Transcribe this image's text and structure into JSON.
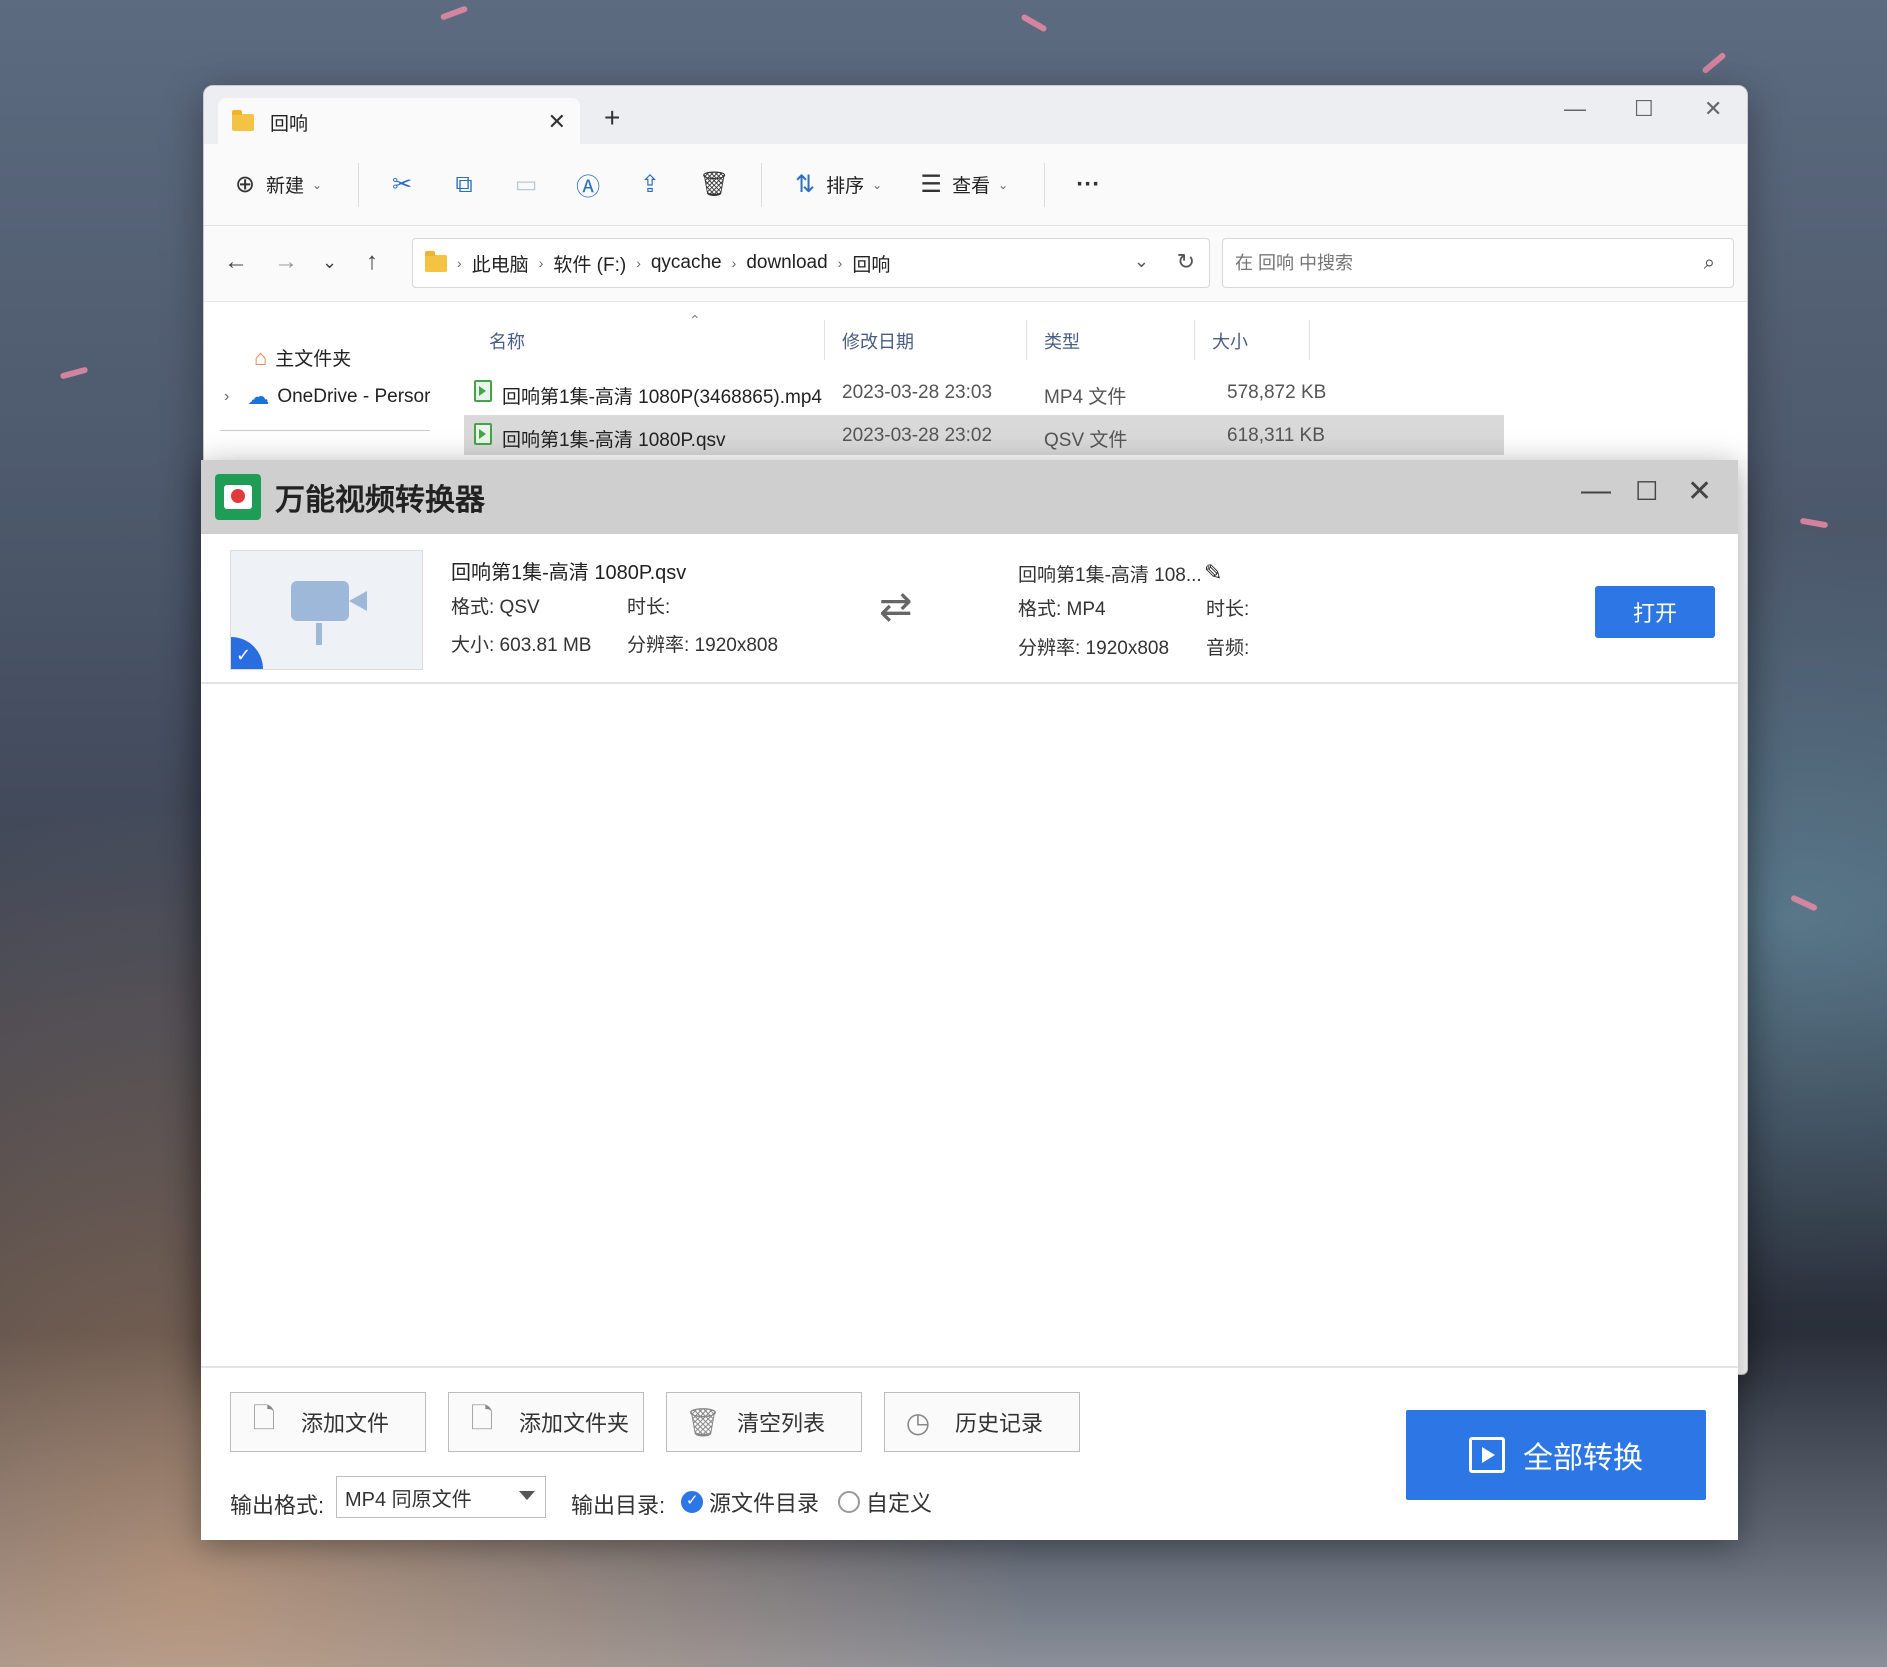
{
  "explorer": {
    "tab_title": "回响",
    "toolbar": {
      "new_label": "新建",
      "sort_label": "排序",
      "view_label": "查看"
    },
    "breadcrumb": [
      "此电脑",
      "软件 (F:)",
      "qycache",
      "download",
      "回响"
    ],
    "search_placeholder": "在 回响 中搜索",
    "sidebar": {
      "home_label": "主文件夹",
      "onedrive_label": "OneDrive - Persor"
    },
    "columns": {
      "name": "名称",
      "date": "修改日期",
      "type": "类型",
      "size": "大小"
    },
    "files": [
      {
        "name": "回响第1集-高清 1080P(3468865).mp4",
        "date": "2023-03-28 23:03",
        "type": "MP4 文件",
        "size": "578,872 KB",
        "selected": false
      },
      {
        "name": "回响第1集-高清 1080P.qsv",
        "date": "2023-03-28 23:02",
        "type": "QSV 文件",
        "size": "618,311 KB",
        "selected": true
      }
    ]
  },
  "converter": {
    "title": "万能视频转换器",
    "source": {
      "name": "回响第1集-高清 1080P.qsv",
      "format": "格式: QSV",
      "duration": "时长:",
      "size": "大小: 603.81 MB",
      "resolution": "分辨率: 1920x808"
    },
    "output": {
      "name": "回响第1集-高清 108...",
      "format": "格式: MP4",
      "duration": "时长:",
      "resolution": "分辨率: 1920x808",
      "audio": "音频:"
    },
    "open_label": "打开",
    "buttons": {
      "add_file": "添加文件",
      "add_folder": "添加文件夹",
      "clear_list": "清空列表",
      "history": "历史记录"
    },
    "output_format_label": "输出格式:",
    "output_format_value": "MP4 同原文件",
    "output_dir_label": "输出目录:",
    "dir_option_source": "源文件目录",
    "dir_option_custom": "自定义",
    "convert_all_label": "全部转换",
    "accent_color": "#2d76e6"
  }
}
